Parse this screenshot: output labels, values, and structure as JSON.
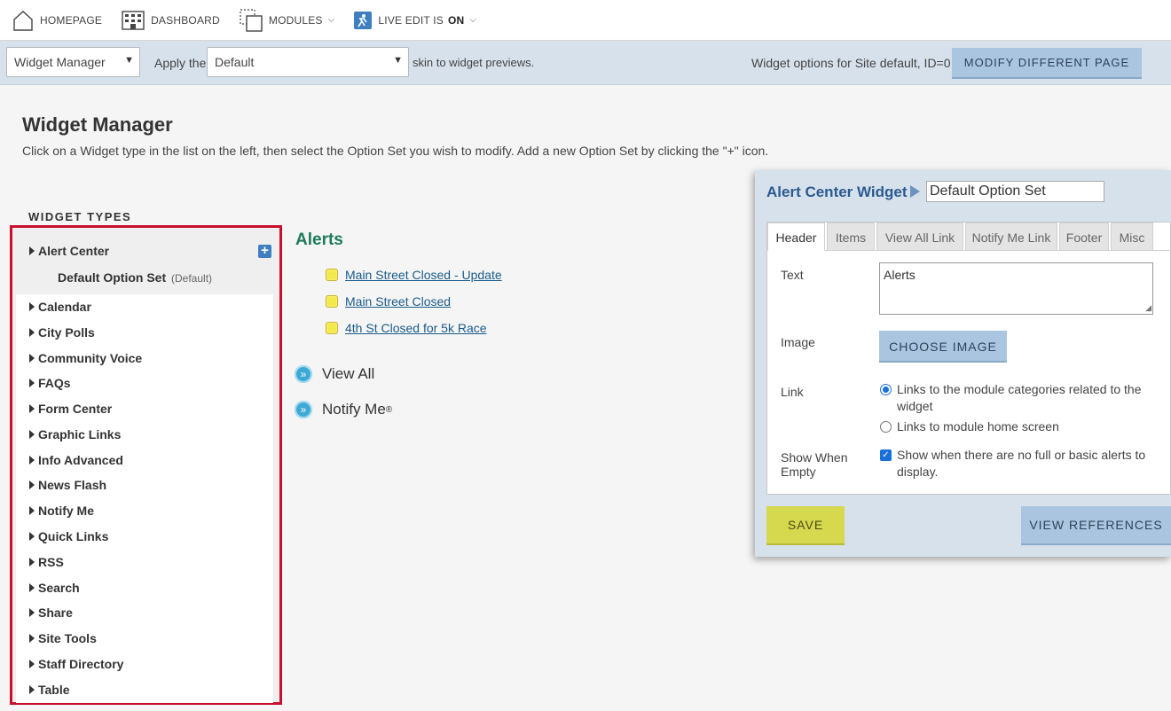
{
  "nav": {
    "homepage": "HOMEPAGE",
    "dashboard": "DASHBOARD",
    "modules": "MODULES",
    "live_edit_label": "LIVE EDIT IS",
    "live_edit_state": "ON"
  },
  "toolbar": {
    "widget_select": "Widget Manager",
    "apply_text": "Apply the",
    "skin_select": "Default",
    "skin_suffix": "skin to widget previews.",
    "options_info": "Widget options for Site default, ID=0",
    "modify_button": "MODIFY DIFFERENT PAGE"
  },
  "page": {
    "title": "Widget Manager",
    "description": "Click on a Widget type in the list on the left, then select the Option Set you wish to modify. Add a new Option Set by clicking the \"+\" icon."
  },
  "widget_types": {
    "heading": "WIDGET TYPES",
    "expanded": {
      "label": "Alert Center",
      "option_set": "Default Option Set",
      "option_set_tag": "(Default)"
    },
    "items": [
      "Calendar",
      "City Polls",
      "Community Voice",
      "FAQs",
      "Form Center",
      "Graphic Links",
      "Info Advanced",
      "News Flash",
      "Notify Me",
      "Quick Links",
      "RSS",
      "Search",
      "Share",
      "Site Tools",
      "Staff Directory",
      "Table"
    ]
  },
  "preview": {
    "title": "Alerts",
    "alerts": [
      "Main Street Closed - Update",
      "Main Street Closed",
      "4th St Closed for 5k Race"
    ],
    "view_all": "View All",
    "notify_me": "Notify Me",
    "notify_me_mark": "®"
  },
  "panel": {
    "title": "Alert Center Widget",
    "option_set_name": "Default Option Set",
    "tabs": [
      "Header",
      "Items",
      "View All Link",
      "Notify Me Link",
      "Footer",
      "Misc"
    ],
    "active_tab": "Header",
    "fields": {
      "text_label": "Text",
      "text_value": "Alerts",
      "image_label": "Image",
      "choose_image": "CHOOSE IMAGE",
      "link_label": "Link",
      "link_option_1": "Links to the module categories related to the widget",
      "link_option_2": "Links to module home screen",
      "show_when_empty_label": "Show When Empty",
      "show_when_empty_text": "Show when there are no full or basic alerts to display."
    },
    "save": "SAVE",
    "view_references": "VIEW REFERENCES"
  },
  "colors": {
    "highlight_border": "#c8102e",
    "preview_title": "#1e7a5c",
    "panel_title": "#2a5a8f",
    "save_button": "#d6d84e",
    "blue_button": "#a9c5e0"
  }
}
